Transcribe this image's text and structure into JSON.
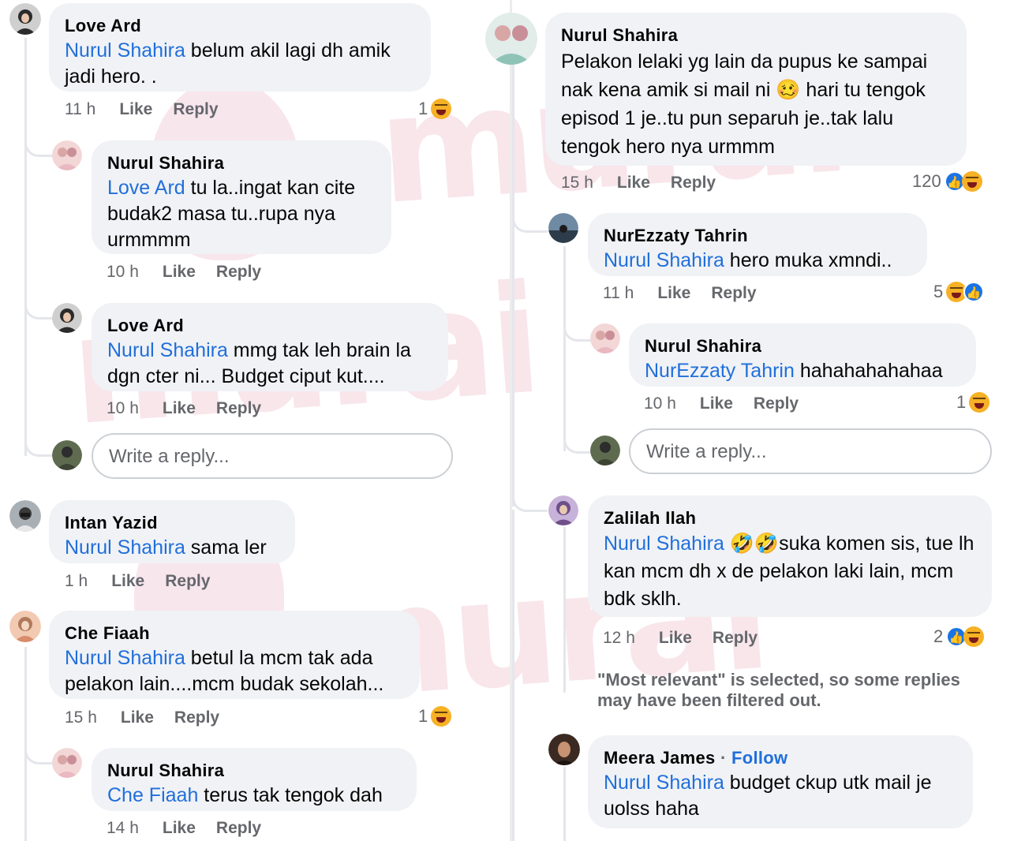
{
  "watermark": "murai",
  "left": {
    "c1": {
      "author": "Love Ard",
      "mention": "Nurul Shahira",
      "text": " belum akil lagi dh amik jadi hero. .",
      "time": "11 h",
      "like": "Like",
      "reply": "Reply",
      "count": "1"
    },
    "c1r1": {
      "author": "Nurul Shahira",
      "mention": "Love Ard",
      "text": " tu la..ingat kan cite budak2 masa tu..rupa nya urmmmm",
      "time": "10 h",
      "like": "Like",
      "reply": "Reply"
    },
    "c1r2": {
      "author": "Love Ard",
      "mention": "Nurul Shahira",
      "text": " mmg tak leh brain la dgn cter ni... Budget ciput kut....",
      "time": "10 h",
      "like": "Like",
      "reply": "Reply"
    },
    "c1input": {
      "placeholder": "Write a reply..."
    },
    "c2": {
      "author": "Intan Yazid",
      "mention": "Nurul Shahira",
      "text": " sama ler",
      "time": "1 h",
      "like": "Like",
      "reply": "Reply"
    },
    "c3": {
      "author": "Che Fiaah",
      "mention": "Nurul Shahira",
      "text": " betul la mcm tak ada pelakon lain....mcm budak sekolah...",
      "time": "15 h",
      "like": "Like",
      "reply": "Reply",
      "count": "1"
    },
    "c3r1": {
      "author": "Nurul Shahira",
      "mention": "Che Fiaah",
      "text": " terus tak tengok dah",
      "time": "14 h",
      "like": "Like",
      "reply": "Reply"
    }
  },
  "right": {
    "c1": {
      "author": "Nurul Shahira",
      "text1": "Pelakon lelaki yg lain da pupus ke sampai nak kena amik si mail ni ",
      "emoji": "🥴",
      "text2": " hari tu tengok episod 1 je..tu pun separuh je..tak lalu tengok hero nya urmmm",
      "time": "15 h",
      "like": "Like",
      "reply": "Reply",
      "count": "120"
    },
    "c1r1": {
      "author": "NurEzzaty Tahrin",
      "mention": "Nurul Shahira",
      "text": " hero muka xmndi..",
      "time": "11 h",
      "like": "Like",
      "reply": "Reply",
      "count": "5"
    },
    "c1r2": {
      "author": "Nurul Shahira",
      "mention": "NurEzzaty Tahrin",
      "text": " hahahahahahaa",
      "time": "10 h",
      "like": "Like",
      "reply": "Reply",
      "count": "1"
    },
    "c1input": {
      "placeholder": "Write a reply..."
    },
    "c2": {
      "author": "Zalilah Ilah",
      "mention": "Nurul Shahira",
      "emoji": " 🤣🤣",
      "text": "suka komen sis, tue lh kan mcm dh x de pelakon laki lain, mcm bdk sklh.",
      "time": "12 h",
      "like": "Like",
      "reply": "Reply",
      "count": "2"
    },
    "note": "\"Most relevant\" is selected, so some replies may have been filtered out.",
    "c3": {
      "author": "Meera James",
      "follow": "Follow",
      "mention": "Nurul Shahira",
      "text": " budget ckup utk mail je uolss haha"
    }
  },
  "colors": {
    "mention": "#216fdb",
    "bubble": "#f0f2f5",
    "meta": "#65676b",
    "like": "#1b74e4",
    "haha": "#f7b125"
  }
}
